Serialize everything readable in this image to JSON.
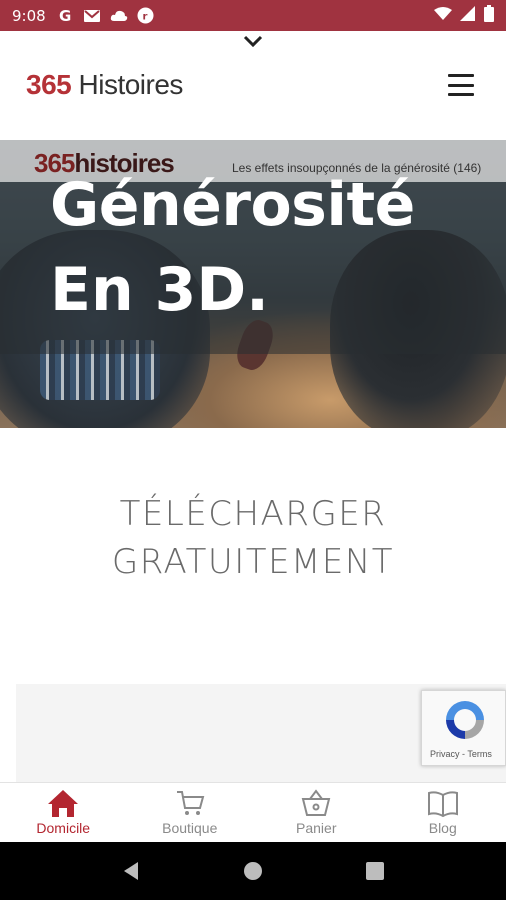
{
  "status_bar": {
    "time": "9:08",
    "icons_left": [
      "google-icon",
      "gmail-icon",
      "cloud-icon",
      "app-notification-icon"
    ],
    "icons_right": [
      "wifi-icon",
      "signal-icon",
      "battery-icon"
    ]
  },
  "header": {
    "brand_number": "365",
    "brand_word": " Histoires"
  },
  "hero": {
    "logo_number": "365",
    "logo_word": "histoires",
    "subtitle": "Les effets insoupçonnés de la générosité (146)",
    "title_line1": "Générosité",
    "title_line2": "En 3D."
  },
  "cta": {
    "line1": "TÉLÉCHARGER",
    "line2": "GRATUITEMENT"
  },
  "recaptcha": {
    "legal": "Privacy - Terms"
  },
  "bottom_nav": {
    "items": [
      {
        "label": "Domicile",
        "active": true
      },
      {
        "label": "Boutique",
        "active": false
      },
      {
        "label": "Panier",
        "active": false
      },
      {
        "label": "Blog",
        "active": false
      }
    ]
  },
  "colors": {
    "status_bar": "#a03340",
    "accent": "#b32630",
    "inactive": "#8a8a8a"
  }
}
